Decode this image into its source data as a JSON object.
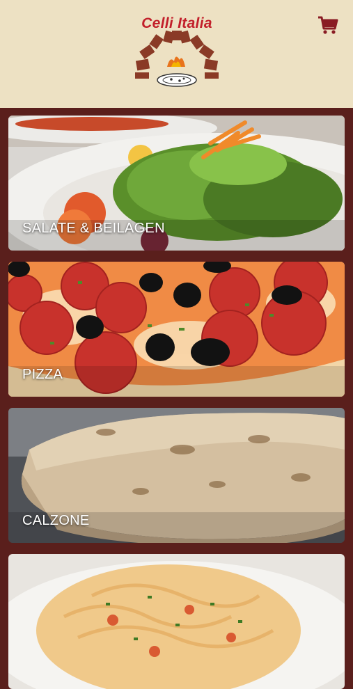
{
  "header": {
    "logo_text": "Celli Italia",
    "cart_icon": "shopping-cart-icon",
    "accent_color": "#8a1c24",
    "background_color": "#ede1c3"
  },
  "categories": [
    {
      "label": "SALATE & BEILAGEN",
      "image": "salad-photo"
    },
    {
      "label": "PIZZA",
      "image": "pizza-photo"
    },
    {
      "label": "CALZONE",
      "image": "calzone-photo"
    },
    {
      "label": "",
      "image": "pasta-photo"
    }
  ]
}
